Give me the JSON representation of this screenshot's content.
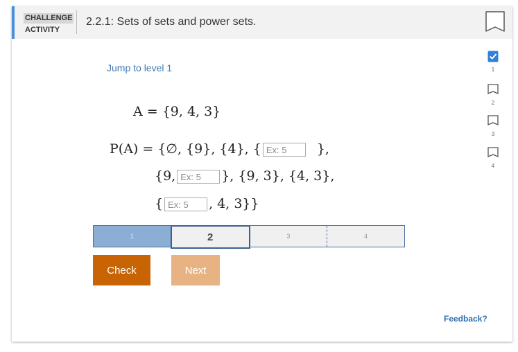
{
  "header": {
    "label_top": "CHALLENGE",
    "label_bottom": "ACTIVITY",
    "title": "2.2.1: Sets of sets and power sets."
  },
  "jump_link": "Jump to level 1",
  "math": {
    "line1": "A = {9, 4, 3}",
    "line2_prefix": "P(A) = {∅, {9}, {4}, {",
    "line2_suffix": "},",
    "line3_prefix": "{9,",
    "line3_suffix": "}, {9, 3}, {4, 3},",
    "line4_prefix": "{",
    "line4_suffix": ", 4, 3}}",
    "input_placeholder": "Ex: 5"
  },
  "levels": [
    {
      "label": "1",
      "state": "done"
    },
    {
      "label": "2",
      "state": "current"
    },
    {
      "label": "3",
      "state": "locked"
    },
    {
      "label": "4",
      "state": "locked"
    }
  ],
  "buttons": {
    "check": "Check",
    "next": "Next"
  },
  "feedback": "Feedback?",
  "side_levels": [
    "1",
    "2",
    "3",
    "4"
  ]
}
